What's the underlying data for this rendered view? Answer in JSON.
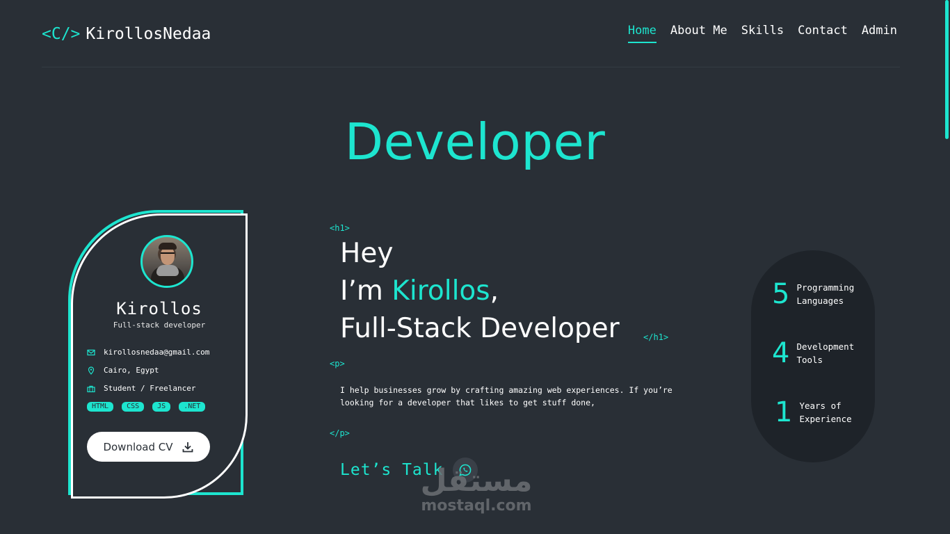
{
  "header": {
    "logo_open": "<C/>",
    "logo_name": "KirollosNedaa",
    "nav": [
      {
        "label": "Home",
        "active": true
      },
      {
        "label": "About Me",
        "active": false
      },
      {
        "label": "Skills",
        "active": false
      },
      {
        "label": "Contact",
        "active": false
      },
      {
        "label": "Admin",
        "active": false
      }
    ]
  },
  "hero": {
    "title": "Developer"
  },
  "profile": {
    "name": "Kirollos",
    "role": "Full-stack developer",
    "email": "kirollosnedaa@gmail.com",
    "location": "Cairo, Egypt",
    "status": "Student / Freelancer",
    "tags": [
      "HTML",
      "CSS",
      "JS",
      ".NET"
    ],
    "download_label": "Download CV"
  },
  "intro": {
    "h1_open": "<h1>",
    "line1": "Hey",
    "line2_prefix": "I’m ",
    "line2_name": "Kirollos",
    "line2_suffix": ",",
    "line3": "Full-Stack Developer",
    "h1_close": "</h1>",
    "p_open": "<p>",
    "bio_line1": "I help businesses grow by crafting amazing web experiences. If you’re",
    "bio_line2": "looking for a developer that likes to get stuff done,",
    "p_close": "</p>",
    "cta": "Let’s Talk"
  },
  "stats": [
    {
      "value": "5",
      "label1": "Programming",
      "label2": "Languages"
    },
    {
      "value": "4",
      "label1": "Development",
      "label2": "Tools"
    },
    {
      "value": "1",
      "label1": "Years of",
      "label2": "Experience"
    }
  ],
  "watermark": {
    "arabic": "مستقل",
    "latin": "mostaql.com"
  },
  "colors": {
    "accent": "#1de5cf",
    "background": "#292f36",
    "stats_bg": "#1e2329"
  }
}
